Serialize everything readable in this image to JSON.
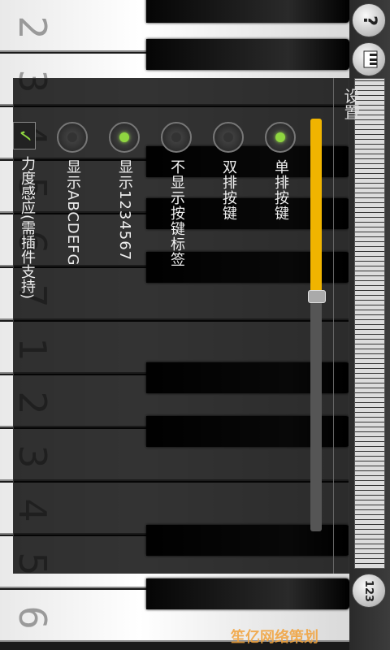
{
  "key_numbers": [
    "2",
    "3",
    "4",
    "5",
    "6",
    "7",
    "1",
    "2",
    "3",
    "4",
    "5",
    "6"
  ],
  "dialog": {
    "title": "设置",
    "options": [
      {
        "label": "单排按键",
        "checked": true
      },
      {
        "label": "双排按键",
        "checked": false
      },
      {
        "label": "不显示按键标签",
        "checked": false
      },
      {
        "label": "显示1234567",
        "checked": true
      },
      {
        "label": "显示ABCDEFG",
        "checked": false
      }
    ],
    "checkbox": {
      "label": "力度感应(需插件支持)",
      "checked": true
    },
    "slider": {
      "value_fraction": 0.43,
      "color": "#f0b400"
    }
  },
  "rail": {
    "help_label": "?",
    "keys_icon": "piano-keys-icon",
    "number_label": "123"
  },
  "watermark": "笙亿网络策划",
  "colors": {
    "accent_green": "#8fd640",
    "accent_yellow": "#f0b400"
  }
}
